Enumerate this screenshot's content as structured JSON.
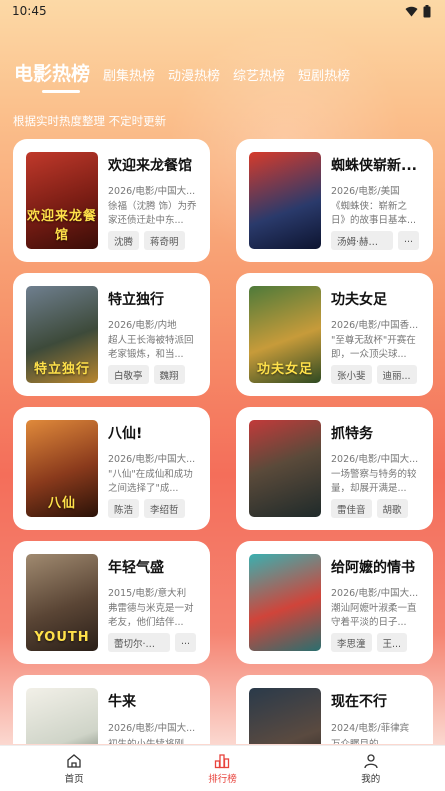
{
  "status_bar": {
    "time": "10:45"
  },
  "tabs": [
    {
      "label": "电影热榜",
      "active": true
    },
    {
      "label": "剧集热榜",
      "active": false
    },
    {
      "label": "动漫热榜",
      "active": false
    },
    {
      "label": "综艺热榜",
      "active": false
    },
    {
      "label": "短剧热榜",
      "active": false
    }
  ],
  "subtitle": "根据实时热度整理 不定时更新",
  "movies": [
    {
      "title": "欢迎来龙餐馆",
      "meta": "2026/电影/中国大...",
      "desc": "徐福（沈腾 饰）为乔家还债迁赴中东...",
      "tags": [
        "沈腾",
        "蒋奇明"
      ],
      "poster_text": "欢迎来龙餐馆"
    },
    {
      "title": "蜘蛛侠崭新...",
      "meta": "2026/电影/美国",
      "desc": "《蜘蛛侠：崭新之日》的故事日基本...",
      "tags": [
        "汤姆·赫兰德",
        "..."
      ],
      "poster_text": ""
    },
    {
      "title": "特立独行",
      "meta": "2026/电影/内地",
      "desc": "超人王长海被特派回老家锻炼，和当...",
      "tags": [
        "白敬亭",
        "魏翔"
      ],
      "poster_text": "特立独行"
    },
    {
      "title": "功夫女足",
      "meta": "2026/电影/中国香...",
      "desc": "\"至尊无敌杯\"开赛在即，一众顶尖球...",
      "tags": [
        "张小斐",
        "迪丽..."
      ],
      "poster_text": "功夫女足"
    },
    {
      "title": "八仙!",
      "meta": "2026/电影/中国大...",
      "desc": "\"八仙\"在成仙和成功之间选择了\"成...",
      "tags": [
        "陈浩",
        "李绍哲"
      ],
      "poster_text": "八仙"
    },
    {
      "title": "抓特务",
      "meta": "2026/电影/中国大...",
      "desc": "一场警察与特务的较量，却展开满是...",
      "tags": [
        "雷佳音",
        "胡歌"
      ],
      "poster_text": ""
    },
    {
      "title": "年轻气盛",
      "meta": "2015/电影/意大利",
      "desc": "弗雷德与米克是一对老友，他们结伴...",
      "tags": [
        "蕾切尔·薇兹",
        "..."
      ],
      "poster_text": "YOUTH"
    },
    {
      "title": "给阿嬷的情书",
      "meta": "2026/电影/中国大...",
      "desc": "潮汕阿嬷叶淑柔一直守着平淡的日子...",
      "tags": [
        "李思潼",
        "王..."
      ],
      "poster_text": ""
    },
    {
      "title": "牛来",
      "meta": "2026/电影/中国大...",
      "desc": "初生的小牛犊将刚",
      "tags": [],
      "poster_text": ""
    },
    {
      "title": "现在不行",
      "meta": "2024/电影/菲律宾",
      "desc": "万众瞩目的",
      "tags": [],
      "poster_text": ""
    }
  ],
  "bottom_nav": [
    {
      "label": "首页",
      "icon": "home-icon",
      "active": false
    },
    {
      "label": "排行榜",
      "icon": "ranking-icon",
      "active": true
    },
    {
      "label": "我的",
      "icon": "user-icon",
      "active": false
    }
  ],
  "colors": {
    "accent": "#e8433c",
    "card_bg": "#ffffff",
    "tag_bg": "#eeeeee"
  }
}
